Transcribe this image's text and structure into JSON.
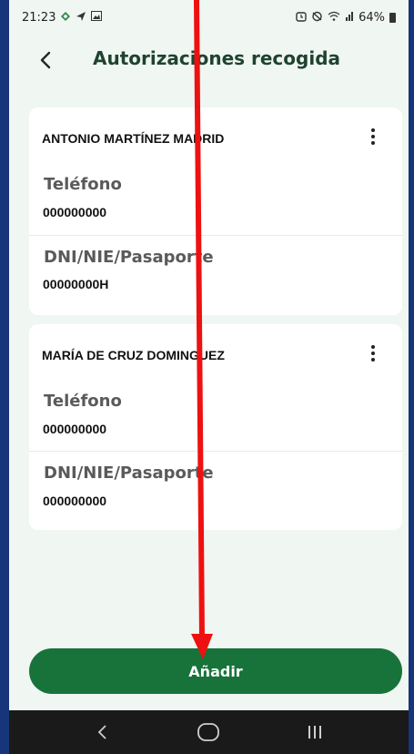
{
  "status_bar": {
    "time": "21:23",
    "left_icons": [
      "signal-app-icon",
      "send-icon",
      "image-icon"
    ],
    "right_icons": [
      "alarm-icon",
      "mute-icon",
      "wifi-icon",
      "cellular-signal-icon"
    ],
    "battery": "64%"
  },
  "header": {
    "back_icon": "chevron-left-icon",
    "title": "Autorizaciones recogida"
  },
  "authorizations": [
    {
      "name": "ANTONIO MARTÍNEZ MADRID",
      "phone_label": "Teléfono",
      "phone_value": "000000000",
      "id_label": "DNI/NIE/Pasaporte",
      "id_value": "00000000H"
    },
    {
      "name": "MARÍA DE CRUZ DOMINGUEZ",
      "phone_label": "Teléfono",
      "phone_value": "000000000",
      "id_label": "DNI/NIE/Pasaporte",
      "id_value": "000000000"
    }
  ],
  "add_button": {
    "label": "Añadir"
  },
  "nav": {
    "icons": [
      "back-nav-icon",
      "home-nav-icon",
      "recents-nav-icon"
    ]
  },
  "colors": {
    "accent_green": "#18733a",
    "title_green": "#1f4330",
    "background": "#f0f6f2",
    "annotation_red": "#ee1111"
  }
}
